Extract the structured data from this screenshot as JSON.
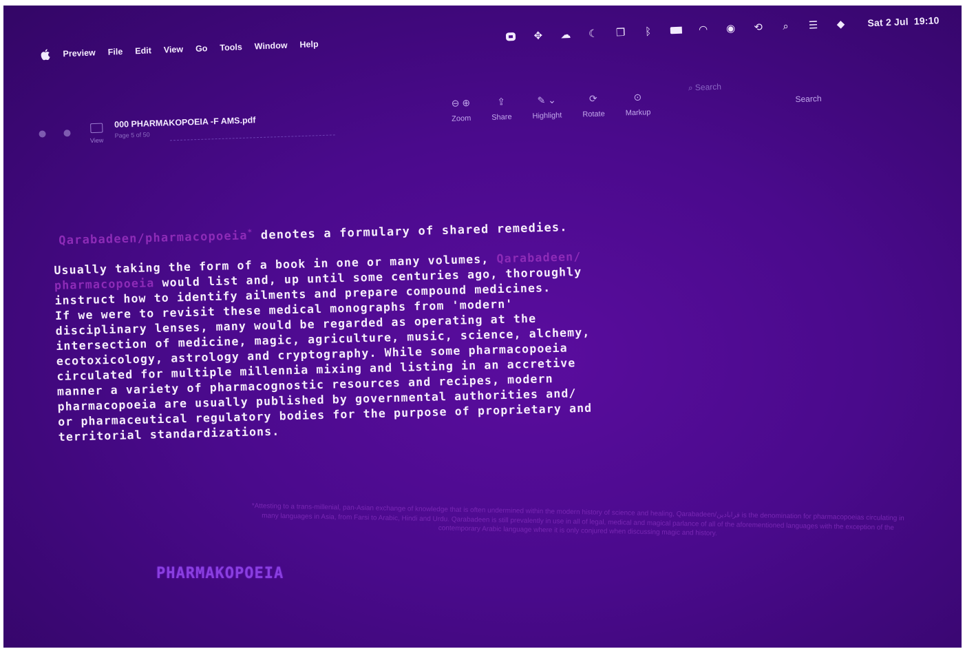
{
  "menubar": {
    "items": [
      "Preview",
      "File",
      "Edit",
      "View",
      "Go",
      "Tools",
      "Window",
      "Help"
    ],
    "status_icons": [
      "app-icon",
      "dropbox-icon",
      "creative-cloud-icon",
      "moon-icon",
      "window-icon",
      "bluetooth-icon",
      "battery-icon",
      "wifi-icon",
      "user-icon",
      "time-machine-icon",
      "search-icon",
      "control-center-icon",
      "siri-icon"
    ],
    "date": "Sat 2 Jul",
    "time": "19:10"
  },
  "toolbar": {
    "view_label": "View",
    "document_title": "000 PHARMAKOPOEIA -F AMS.pdf",
    "page_info": "Page 5 of 50",
    "zoom_label": "Zoom",
    "share_label": "Share",
    "highlight_label": "Highlight",
    "rotate_label": "Rotate",
    "markup_label": "Markup",
    "search_placeholder": "Search",
    "search_label": "Search"
  },
  "document": {
    "heading_term1": "Qarabadeen",
    "heading_sep": "/",
    "heading_term2": "pharmacopoeia",
    "heading_mark": "*",
    "heading_text": " denotes a formulary of shared remedies.",
    "body_line1_a": "Usually taking the form of a book in one or many volumes, ",
    "body_line1_hl": "Qarabadeen/",
    "body_line2_hl": "pharmacopoeia",
    "body_line2_rest": " would list and, up until some centuries ago, thoroughly",
    "body_rest": "instruct how to identify ailments and prepare compound medicines.\nIf we were to revisit these medical monographs from 'modern'\ndisciplinary lenses, many would be regarded as operating at the\nintersection of medicine, magic, agriculture, music, science, alchemy,\necotoxicology, astrology and cryptography. While some pharmacopoeia\ncirculated for multiple millennia mixing and listing in an accretive\nmanner a variety of pharmacognostic resources and recipes, modern\npharmacopoeia are usually published by governmental authorities and/\nor pharmaceutical regulatory bodies for the purpose of proprietary and\nterritorial standardizations.",
    "footnote": "*Attesting to a trans-millenial, pan-Asian exchange of knowledge that is often undermined within the modern history of science and healing, Qarabadeen/قرابادین is the denomination for pharmacopoeias circulating in many languages in Asia, from Farsi to Arabic, Hindi and Urdu. Qarabadeen is still prevalently in use in all of legal, medical and magical parlance of all of the aforementioned languages with the exception of the contemporary Arabic language where it is only conjured when discussing magic and history.",
    "logo": "PHARMAKOPOEIA"
  }
}
